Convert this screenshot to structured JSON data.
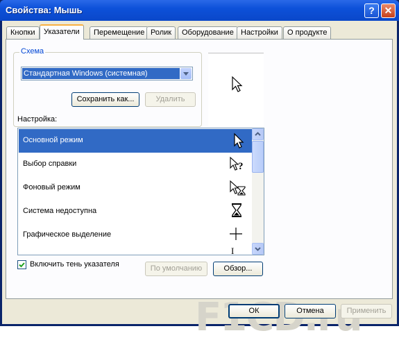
{
  "window": {
    "title": "Свойства: Мышь",
    "help_label": "?",
    "close_label": "✕"
  },
  "tabs": [
    {
      "label": "Кнопки"
    },
    {
      "label": "Указатели"
    },
    {
      "label": "Перемещение"
    },
    {
      "label": "Ролик"
    },
    {
      "label": "Оборудование"
    },
    {
      "label": "Настройки"
    },
    {
      "label": "О продукте"
    }
  ],
  "active_tab": "Указатели",
  "scheme": {
    "legend": "Схема",
    "selected": "Стандартная Windows (системная)",
    "save_as_label": "Сохранить как...",
    "delete_label": "Удалить"
  },
  "customize": {
    "label": "Настройка:",
    "items": [
      {
        "label": "Основной режим",
        "icon": "arrow-cursor-icon"
      },
      {
        "label": "Выбор справки",
        "icon": "help-select-cursor-icon"
      },
      {
        "label": "Фоновый режим",
        "icon": "working-in-background-cursor-icon"
      },
      {
        "label": "Система недоступна",
        "icon": "busy-hourglass-cursor-icon"
      },
      {
        "label": "Графическое выделение",
        "icon": "crosshair-cursor-icon"
      }
    ],
    "partial_glyph": "I"
  },
  "shadow_checkbox": {
    "label": "Включить тень указателя",
    "checked": true
  },
  "buttons": {
    "default_label": "По умолчанию",
    "browse_label": "Обзор...",
    "ok_label": "ОК",
    "cancel_label": "Отмена",
    "apply_label": "Применить"
  },
  "watermark": "F1CD.ru",
  "colors": {
    "selection": "#316ac5",
    "titlebar": "#0a47c9",
    "group_legend": "#0046d5"
  }
}
